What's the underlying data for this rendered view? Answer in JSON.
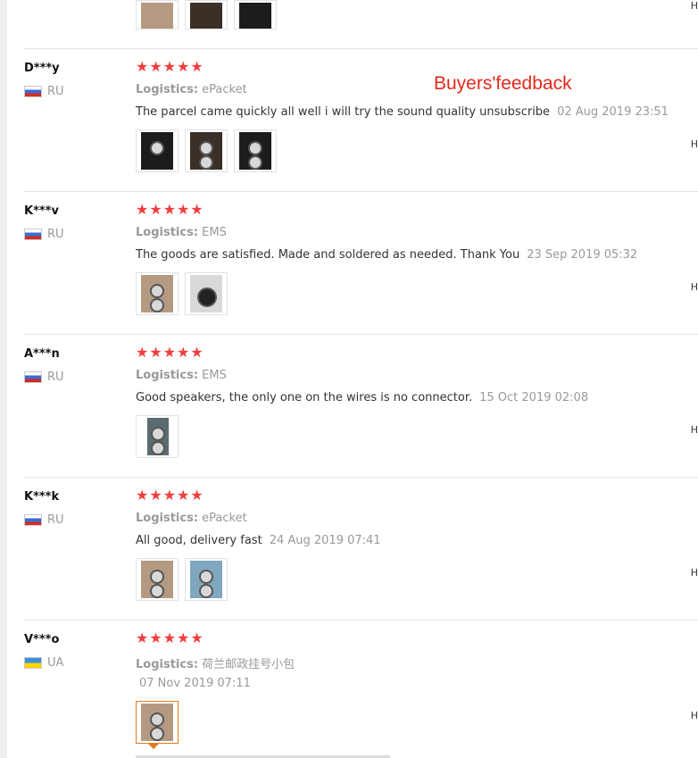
{
  "annotation": "Buyers'feedback",
  "star_icon": "★",
  "cut_label": "H",
  "reviews": [
    {
      "user": "D***y",
      "country": "RU",
      "logistics_label": "Logistics:",
      "logistics": "ePacket",
      "feedback": "The parcel came quickly all well i will try the sound quality unsubscribe",
      "date": "02 Aug 2019 23:51",
      "rating": 5
    },
    {
      "user": "K***v",
      "country": "RU",
      "logistics_label": "Logistics:",
      "logistics": "EMS",
      "feedback": "The goods are satisfied. Made and soldered as needed. Thank You",
      "date": "23 Sep 2019 05:32",
      "rating": 5
    },
    {
      "user": "A***n",
      "country": "RU",
      "logistics_label": "Logistics:",
      "logistics": "EMS",
      "feedback": "Good speakers, the only one on the wires is no connector.",
      "date": "15 Oct 2019 02:08",
      "rating": 5
    },
    {
      "user": "K***k",
      "country": "RU",
      "logistics_label": "Logistics:",
      "logistics": "ePacket",
      "feedback": "All good, delivery fast",
      "date": "24 Aug 2019 07:41",
      "rating": 5
    },
    {
      "user": "V***o",
      "country": "UA",
      "logistics_label": "Logistics:",
      "logistics": "荷兰邮政挂号小包",
      "feedback": "",
      "date": "07 Nov 2019 07:11",
      "rating": 5
    }
  ]
}
